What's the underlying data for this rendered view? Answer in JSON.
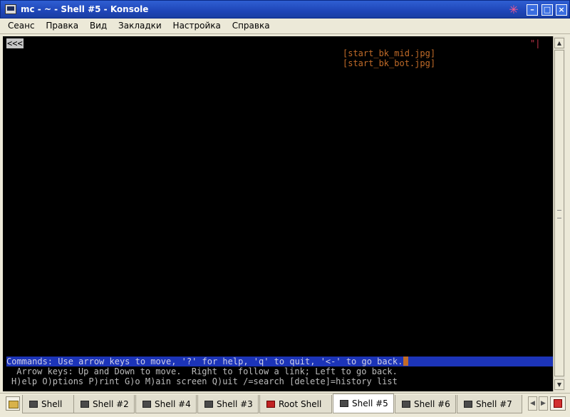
{
  "window": {
    "title": "mc - ~ - Shell #5 - Konsole",
    "buttons": {
      "sticky": "✳",
      "minimize": "–",
      "maximize": "□",
      "close": "×"
    }
  },
  "menu": [
    "Сеанс",
    "Правка",
    "Вид",
    "Закладки",
    "Настройка",
    "Справка"
  ],
  "terminal": {
    "back_link": "<<<",
    "marker": "\"|",
    "links": [
      "[start_bk_mid.jpg]",
      "[start_bk_bot.jpg]"
    ],
    "status_line": "Commands: Use arrow keys to move, '?' for help, 'q' to quit, '<-' to go back.",
    "help_line1": " Arrow keys: Up and Down to move.  Right to follow a link; Left to go back.",
    "help_line2": "H)elp O)ptions P)rint G)o M)ain screen Q)uit /=search [delete]=history list",
    "colors": {
      "background": "#000000",
      "link": "#c16b28",
      "status_bg": "#1c34b8"
    }
  },
  "tabs": [
    {
      "label": "Shell",
      "icon": "terminal-icon",
      "active": false
    },
    {
      "label": "Shell #2",
      "icon": "terminal-icon",
      "active": false
    },
    {
      "label": "Shell #4",
      "icon": "terminal-icon",
      "active": false
    },
    {
      "label": "Shell #3",
      "icon": "terminal-icon",
      "active": false
    },
    {
      "label": "Root Shell",
      "icon": "root-terminal-icon",
      "active": false
    },
    {
      "label": "Shell #5",
      "icon": "terminal-icon",
      "active": true
    },
    {
      "label": "Shell #6",
      "icon": "terminal-icon",
      "active": false
    },
    {
      "label": "Shell #7",
      "icon": "terminal-icon",
      "active": false
    }
  ],
  "tabnav": {
    "left": "◀",
    "right": "▶"
  },
  "scrollbar": {
    "up": "▲",
    "down": "▼"
  }
}
